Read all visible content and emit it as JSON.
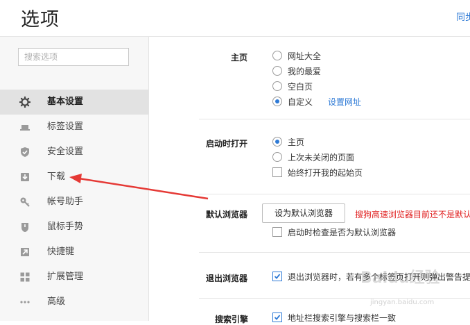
{
  "header": {
    "title": "选项",
    "sync_link": "同步"
  },
  "sidebar": {
    "search_placeholder": "搜索选项",
    "items": [
      {
        "label": "基本设置",
        "icon": "gear-icon",
        "active": true
      },
      {
        "label": "标签设置",
        "icon": "tab-icon"
      },
      {
        "label": "安全设置",
        "icon": "shield-check-icon"
      },
      {
        "label": "下载",
        "icon": "download-icon"
      },
      {
        "label": "帐号助手",
        "icon": "key-icon"
      },
      {
        "label": "鼠标手势",
        "icon": "mouse-icon"
      },
      {
        "label": "快捷键",
        "icon": "shortcut-arrow-icon"
      },
      {
        "label": "扩展管理",
        "icon": "extensions-grid-icon"
      },
      {
        "label": "高级",
        "icon": "more-dots-icon"
      }
    ]
  },
  "homepage": {
    "label": "主页",
    "options": [
      {
        "label": "网址大全",
        "selected": false
      },
      {
        "label": "我的最爱",
        "selected": false
      },
      {
        "label": "空白页",
        "selected": false
      },
      {
        "label": "自定义",
        "selected": true
      }
    ],
    "set_url_link": "设置网址"
  },
  "startup": {
    "label": "启动时打开",
    "options": [
      {
        "label": "主页",
        "selected": true
      },
      {
        "label": "上次未关闭的页面",
        "selected": false
      }
    ],
    "always_open_start": {
      "label": "始终打开我的起始页",
      "checked": false
    }
  },
  "default_browser": {
    "label": "默认浏览器",
    "button": "设为默认浏览器",
    "warning": "搜狗高速浏览器目前还不是默认",
    "check_on_start": {
      "label": "启动时检查是否为默认浏览器",
      "checked": false
    }
  },
  "exit_browser": {
    "label": "退出浏览器",
    "option": {
      "label": "退出浏览器时，若有多个标签页打开则弹出警告提",
      "checked": true
    }
  },
  "search_engine": {
    "label": "搜索引擎",
    "option": {
      "label": "地址栏搜索引擎与搜索栏一致",
      "checked": true
    }
  },
  "watermark": {
    "text": "Baidu经验",
    "subtext": "jingyan.baidu.com"
  },
  "colors": {
    "accent": "#2e7ad6",
    "warning": "#e02020",
    "arrow": "#e53935"
  }
}
